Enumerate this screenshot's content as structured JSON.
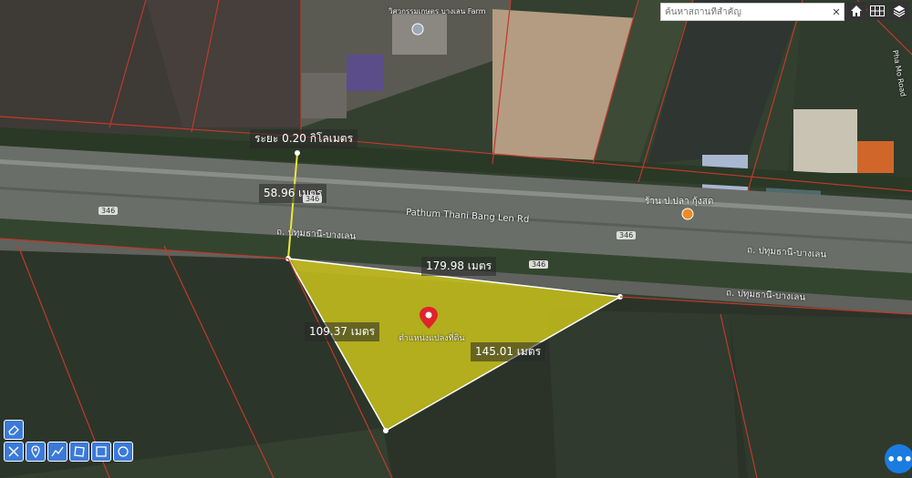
{
  "search": {
    "placeholder": "ค้นหาสถานที่สำคัญ",
    "clear_icon": "close-icon"
  },
  "top_buttons": [
    {
      "name": "home-button",
      "icon": "home-icon"
    },
    {
      "name": "grid-button",
      "icon": "grid-icon"
    },
    {
      "name": "layers-button",
      "icon": "layers-icon"
    }
  ],
  "measurements": {
    "top_distance": "ระยะ 0.20 กิโลเมตร",
    "north_segment": "58.96 เมตร",
    "top_edge": "179.98 เมตร",
    "left_edge": "109.37 เมตร",
    "right_edge": "145.01 เมตร"
  },
  "parcel_label": "ตำแหน่งแปลงที่ดิน",
  "road_labels": {
    "main_road": "Pathum Thani Bang Len Rd",
    "road_th_1": "ถ. ปทุมธานี-บางเลน",
    "road_th_2": "ถ. ปทุมธานี-บางเลน",
    "road_th_3": "ถ. ปทุมธานี-บางเลน",
    "shop": "ร้าน ป.ปลา กุ้งสด",
    "farm": "วิศวกรรมเกษตร บางเลน Farm",
    "side_road": "Pha Mo Road",
    "shield_346": "346"
  },
  "tools": [
    {
      "name": "eraser-tool",
      "icon": "eraser-icon"
    },
    {
      "name": "cross-tool",
      "icon": "cross-tools-icon"
    },
    {
      "name": "marker-tool",
      "icon": "map-pin-icon"
    },
    {
      "name": "line-tool",
      "icon": "polyline-icon"
    },
    {
      "name": "polygon-tool",
      "icon": "polygon-icon"
    },
    {
      "name": "rectangle-tool",
      "icon": "rectangle-icon"
    },
    {
      "name": "circle-tool",
      "icon": "circle-icon"
    }
  ],
  "more_button": "•••",
  "colors": {
    "parcel_fill": "#c9c21a",
    "boundary": "#c0392b",
    "measure_line": "#e8e83a",
    "tool_blue": "#3b7ad9",
    "fab_blue": "#1c7be0",
    "pin_red": "#e0232c"
  }
}
